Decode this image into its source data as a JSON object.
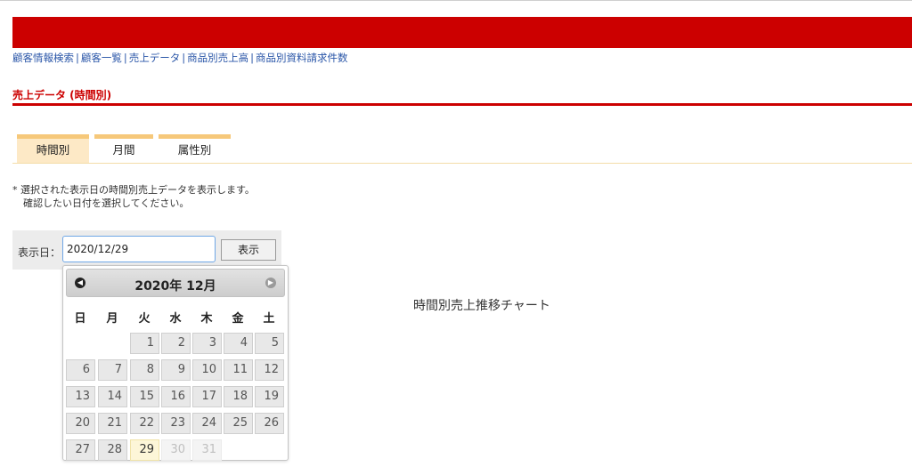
{
  "nav": {
    "items": [
      "顧客情報検索",
      "顧客一覧",
      "売上データ",
      "商品別売上高",
      "商品別資料請求件数"
    ],
    "separator": "|"
  },
  "page_title": "売上データ (時間別)",
  "tabs": [
    {
      "label": "時間別",
      "active": true
    },
    {
      "label": "月間",
      "active": false
    },
    {
      "label": "属性別",
      "active": false
    }
  ],
  "note": {
    "line1": "* 選択された表示日の時間別売上データを表示します。",
    "line2": "確認したい日付を選択してください。"
  },
  "filter": {
    "label": "表示日：",
    "date_value": "2020/12/29",
    "button_label": "表示"
  },
  "chart_title": "時間別売上推移チャート",
  "datepicker": {
    "title": "2020年 12月",
    "prev_icon": "prev-month-icon",
    "next_icon": "next-month-icon",
    "weekdays": [
      "日",
      "月",
      "火",
      "水",
      "木",
      "金",
      "土"
    ],
    "weeks": [
      [
        "",
        "",
        "1",
        "2",
        "3",
        "4",
        "5"
      ],
      [
        "6",
        "7",
        "8",
        "9",
        "10",
        "11",
        "12"
      ],
      [
        "13",
        "14",
        "15",
        "16",
        "17",
        "18",
        "19"
      ],
      [
        "20",
        "21",
        "22",
        "23",
        "24",
        "25",
        "26"
      ],
      [
        "27",
        "28",
        "29",
        "30",
        "31",
        "",
        ""
      ]
    ],
    "selected_day": "29",
    "disabled_days": [
      "30",
      "31"
    ]
  },
  "colors": {
    "brand_red": "#cc0000",
    "link_blue": "#2a56a8",
    "tab_accent": "#f6c87a",
    "today_highlight": "#fdf6d8"
  }
}
